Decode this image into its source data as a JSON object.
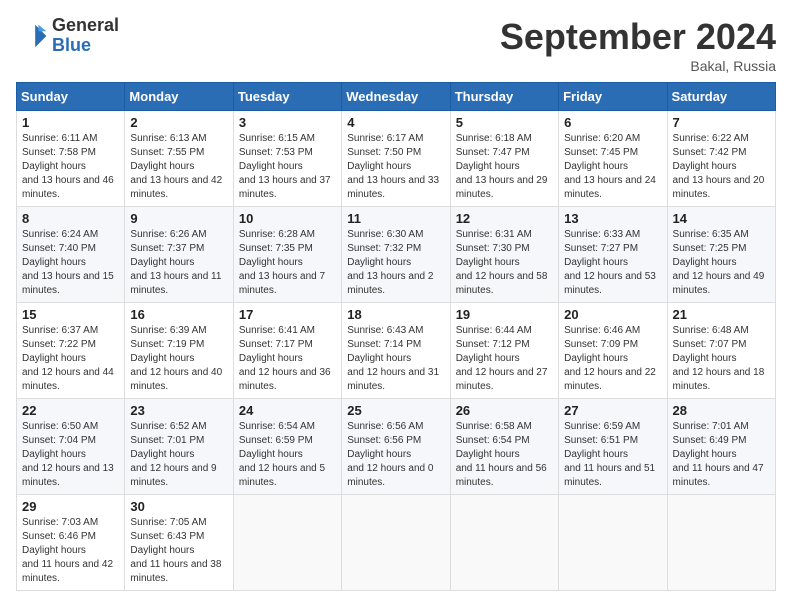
{
  "header": {
    "logo_line1": "General",
    "logo_line2": "Blue",
    "month_title": "September 2024",
    "location": "Bakal, Russia"
  },
  "days_of_week": [
    "Sunday",
    "Monday",
    "Tuesday",
    "Wednesday",
    "Thursday",
    "Friday",
    "Saturday"
  ],
  "weeks": [
    [
      {
        "day": "1",
        "sunrise": "6:11 AM",
        "sunset": "7:58 PM",
        "daylight": "13 hours and 46 minutes."
      },
      {
        "day": "2",
        "sunrise": "6:13 AM",
        "sunset": "7:55 PM",
        "daylight": "13 hours and 42 minutes."
      },
      {
        "day": "3",
        "sunrise": "6:15 AM",
        "sunset": "7:53 PM",
        "daylight": "13 hours and 37 minutes."
      },
      {
        "day": "4",
        "sunrise": "6:17 AM",
        "sunset": "7:50 PM",
        "daylight": "13 hours and 33 minutes."
      },
      {
        "day": "5",
        "sunrise": "6:18 AM",
        "sunset": "7:47 PM",
        "daylight": "13 hours and 29 minutes."
      },
      {
        "day": "6",
        "sunrise": "6:20 AM",
        "sunset": "7:45 PM",
        "daylight": "13 hours and 24 minutes."
      },
      {
        "day": "7",
        "sunrise": "6:22 AM",
        "sunset": "7:42 PM",
        "daylight": "13 hours and 20 minutes."
      }
    ],
    [
      {
        "day": "8",
        "sunrise": "6:24 AM",
        "sunset": "7:40 PM",
        "daylight": "13 hours and 15 minutes."
      },
      {
        "day": "9",
        "sunrise": "6:26 AM",
        "sunset": "7:37 PM",
        "daylight": "13 hours and 11 minutes."
      },
      {
        "day": "10",
        "sunrise": "6:28 AM",
        "sunset": "7:35 PM",
        "daylight": "13 hours and 7 minutes."
      },
      {
        "day": "11",
        "sunrise": "6:30 AM",
        "sunset": "7:32 PM",
        "daylight": "13 hours and 2 minutes."
      },
      {
        "day": "12",
        "sunrise": "6:31 AM",
        "sunset": "7:30 PM",
        "daylight": "12 hours and 58 minutes."
      },
      {
        "day": "13",
        "sunrise": "6:33 AM",
        "sunset": "7:27 PM",
        "daylight": "12 hours and 53 minutes."
      },
      {
        "day": "14",
        "sunrise": "6:35 AM",
        "sunset": "7:25 PM",
        "daylight": "12 hours and 49 minutes."
      }
    ],
    [
      {
        "day": "15",
        "sunrise": "6:37 AM",
        "sunset": "7:22 PM",
        "daylight": "12 hours and 44 minutes."
      },
      {
        "day": "16",
        "sunrise": "6:39 AM",
        "sunset": "7:19 PM",
        "daylight": "12 hours and 40 minutes."
      },
      {
        "day": "17",
        "sunrise": "6:41 AM",
        "sunset": "7:17 PM",
        "daylight": "12 hours and 36 minutes."
      },
      {
        "day": "18",
        "sunrise": "6:43 AM",
        "sunset": "7:14 PM",
        "daylight": "12 hours and 31 minutes."
      },
      {
        "day": "19",
        "sunrise": "6:44 AM",
        "sunset": "7:12 PM",
        "daylight": "12 hours and 27 minutes."
      },
      {
        "day": "20",
        "sunrise": "6:46 AM",
        "sunset": "7:09 PM",
        "daylight": "12 hours and 22 minutes."
      },
      {
        "day": "21",
        "sunrise": "6:48 AM",
        "sunset": "7:07 PM",
        "daylight": "12 hours and 18 minutes."
      }
    ],
    [
      {
        "day": "22",
        "sunrise": "6:50 AM",
        "sunset": "7:04 PM",
        "daylight": "12 hours and 13 minutes."
      },
      {
        "day": "23",
        "sunrise": "6:52 AM",
        "sunset": "7:01 PM",
        "daylight": "12 hours and 9 minutes."
      },
      {
        "day": "24",
        "sunrise": "6:54 AM",
        "sunset": "6:59 PM",
        "daylight": "12 hours and 5 minutes."
      },
      {
        "day": "25",
        "sunrise": "6:56 AM",
        "sunset": "6:56 PM",
        "daylight": "12 hours and 0 minutes."
      },
      {
        "day": "26",
        "sunrise": "6:58 AM",
        "sunset": "6:54 PM",
        "daylight": "11 hours and 56 minutes."
      },
      {
        "day": "27",
        "sunrise": "6:59 AM",
        "sunset": "6:51 PM",
        "daylight": "11 hours and 51 minutes."
      },
      {
        "day": "28",
        "sunrise": "7:01 AM",
        "sunset": "6:49 PM",
        "daylight": "11 hours and 47 minutes."
      }
    ],
    [
      {
        "day": "29",
        "sunrise": "7:03 AM",
        "sunset": "6:46 PM",
        "daylight": "11 hours and 42 minutes."
      },
      {
        "day": "30",
        "sunrise": "7:05 AM",
        "sunset": "6:43 PM",
        "daylight": "11 hours and 38 minutes."
      },
      null,
      null,
      null,
      null,
      null
    ]
  ],
  "labels": {
    "sunrise": "Sunrise:",
    "sunset": "Sunset:",
    "daylight": "Daylight hours"
  }
}
